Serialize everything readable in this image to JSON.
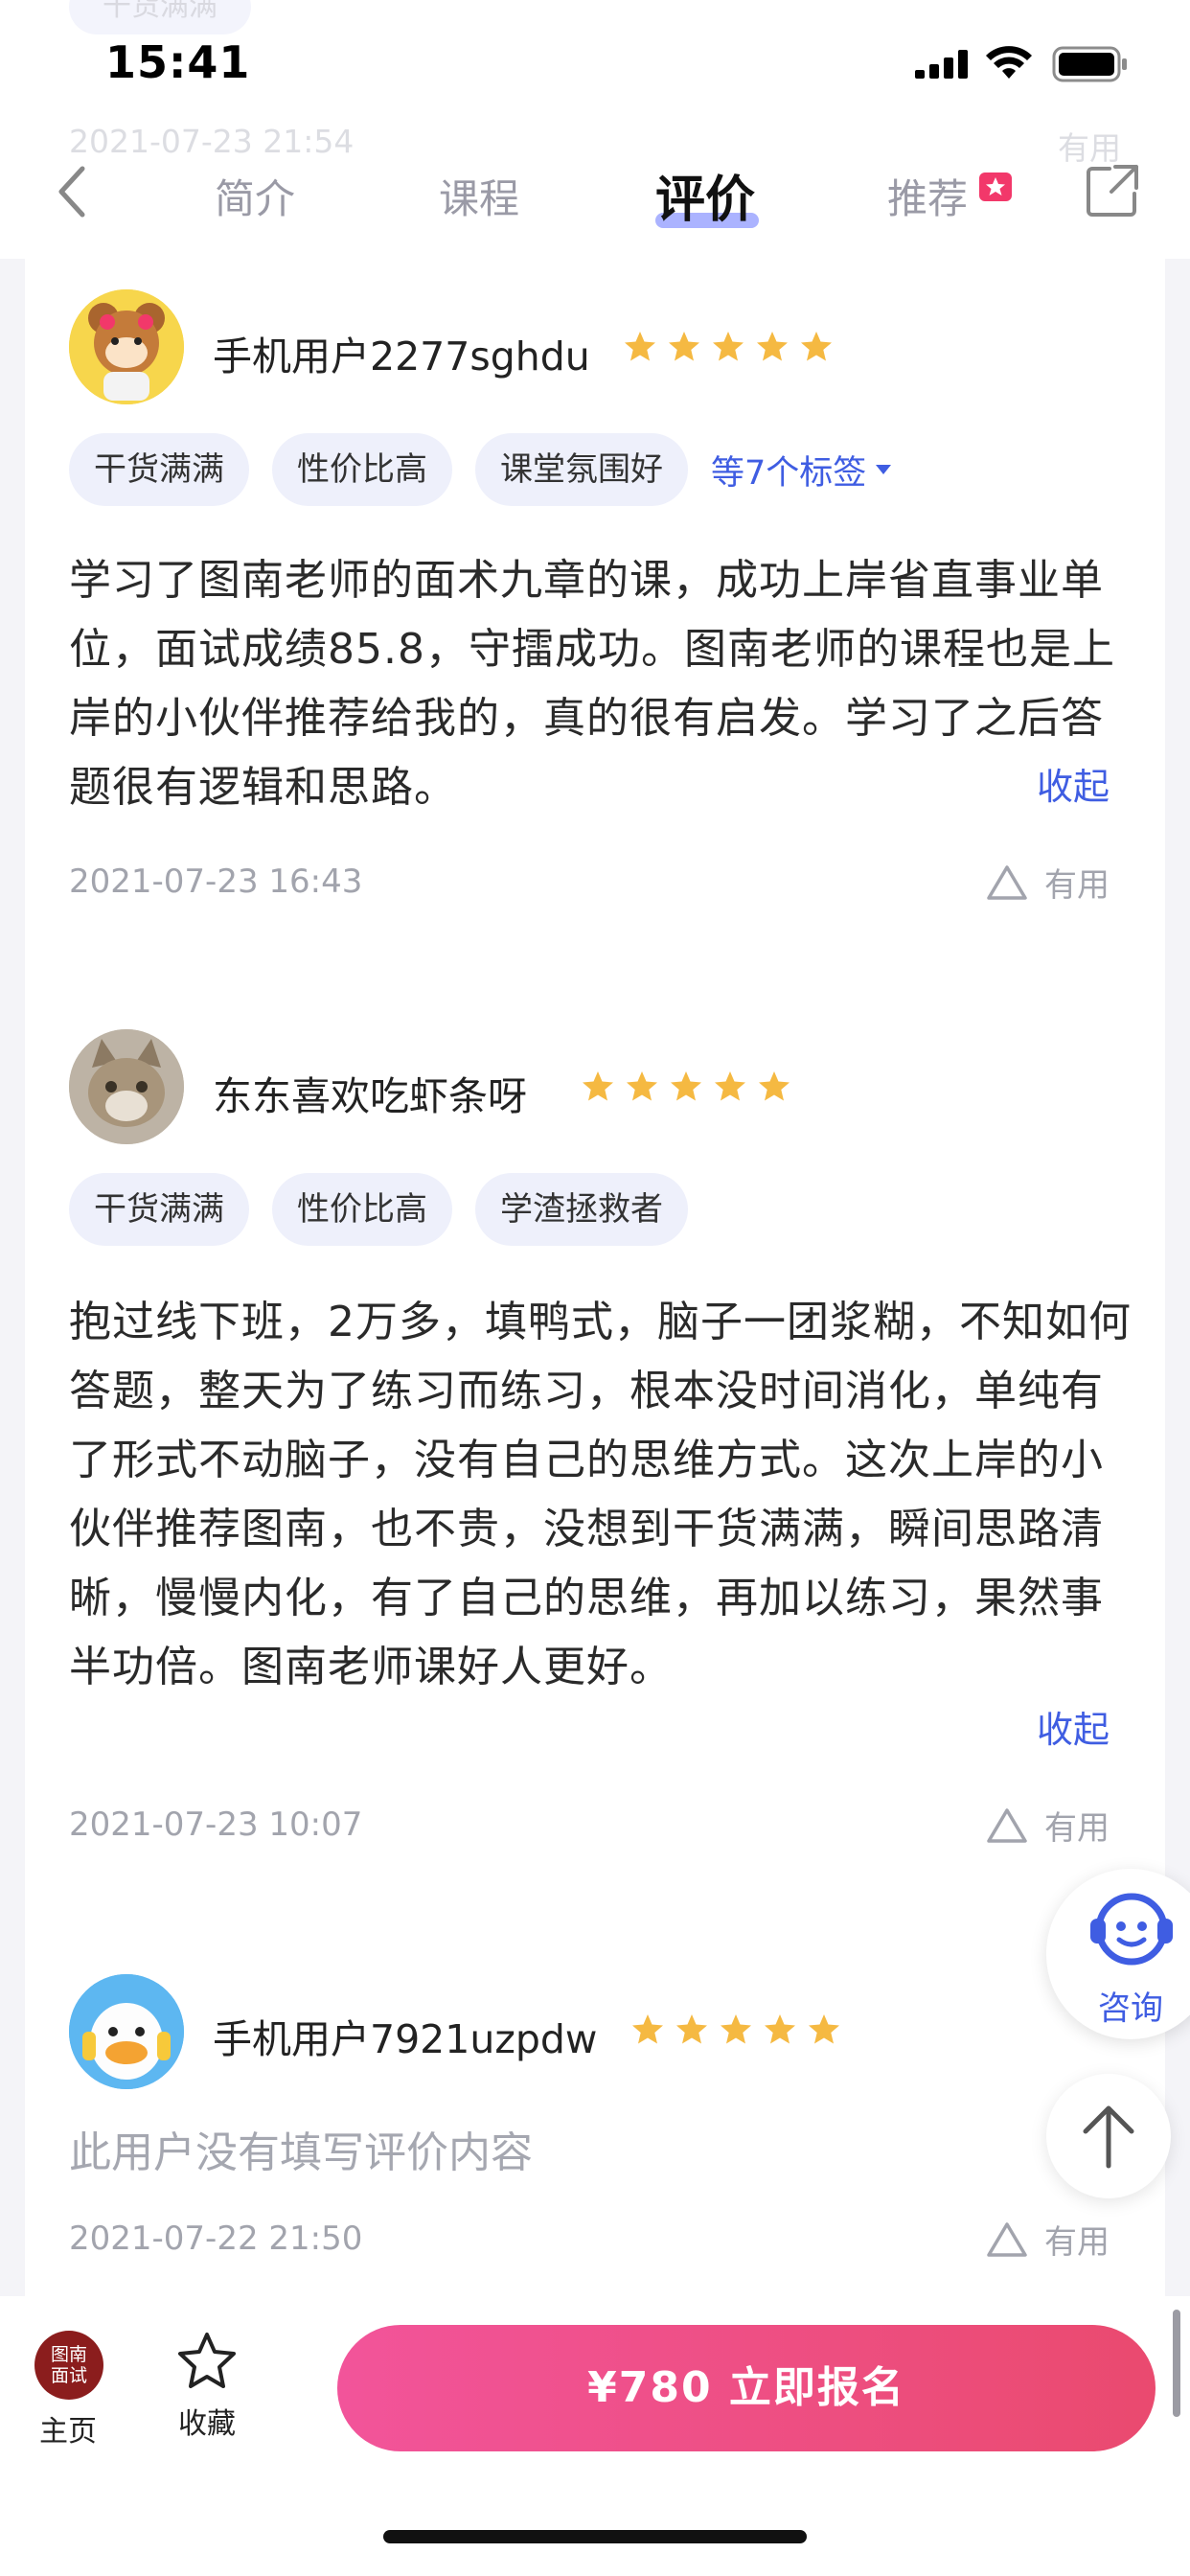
{
  "ghost": {
    "tag": "干货满满",
    "date": "2021-07-23 21:54",
    "useful": "有用"
  },
  "status_bar": {
    "time": "15:41"
  },
  "nav": {
    "tabs": [
      {
        "label": "简介"
      },
      {
        "label": "课程"
      },
      {
        "label": "评价",
        "active": true
      },
      {
        "label": "推荐"
      }
    ]
  },
  "reviews": [
    {
      "user": "手机用户2277sghdu",
      "rating": 5,
      "tags": [
        "干货满满",
        "性价比高",
        "课堂氛围好"
      ],
      "more_tags": "等7个标签",
      "text": "学习了图南老师的面术九章的课，成功上岸省直事业单位，面试成绩85.8，守擂成功。图南老师的课程也是上岸的小伙伴推荐给我的，真的很有启发。学习了之后答题很有逻辑和思路。",
      "collapse": "收起",
      "date": "2021-07-23 16:43",
      "useful": "有用"
    },
    {
      "user": "东东喜欢吃虾条呀",
      "rating": 5,
      "tags": [
        "干货满满",
        "性价比高",
        "学渣拯救者"
      ],
      "text": "抱过线下班，2万多，填鸭式，脑子一团浆糊，不知如何答题，整天为了练习而练习，根本没时间消化，单纯有了形式不动脑子，没有自己的思维方式。这次上岸的小伙伴推荐图南，也不贵，没想到干货满满，瞬间思路清晰，慢慢内化，有了自己的思维，再加以练习，果然事半功倍。图南老师课好人更好。",
      "collapse": "收起",
      "date": "2021-07-23 10:07",
      "useful": "有用"
    },
    {
      "user": "手机用户7921uzpdw",
      "rating": 5,
      "text": "此用户没有填写评价内容",
      "date": "2021-07-22 21:50",
      "useful": "有用"
    }
  ],
  "floating": {
    "consult_label": "咨询"
  },
  "bottom_bar": {
    "home_logo": "图南面试",
    "home_label": "主页",
    "fav_label": "收藏",
    "buy_label": "¥780  立即报名"
  },
  "colors": {
    "accent": "#3f5de2",
    "star": "#f5b942",
    "buy_start": "#f2549a",
    "buy_end": "#ea4a6f"
  }
}
